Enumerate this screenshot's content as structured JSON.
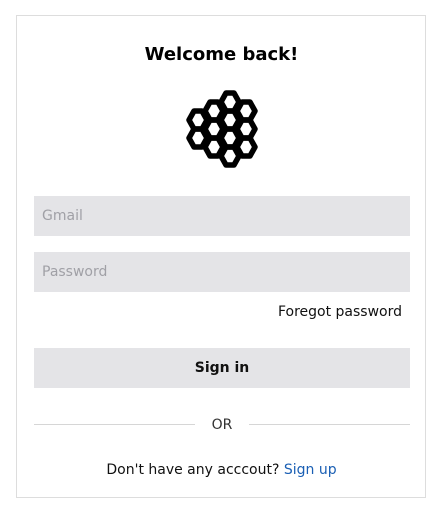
{
  "header": {
    "title": "Welcome back!"
  },
  "logo": {
    "icon": "honeycomb-icon",
    "color": "#000000"
  },
  "form": {
    "gmail": {
      "placeholder": "Gmail",
      "value": ""
    },
    "password": {
      "placeholder": "Password",
      "value": ""
    },
    "forgot_label": "Foregot password",
    "signin_label": "Sign in"
  },
  "divider": {
    "label": "OR"
  },
  "signup": {
    "prompt": "Don't have any acccout?",
    "link_label": "Sign up",
    "link_color": "#1a5fb4"
  },
  "colors": {
    "field_background": "#e4e4e7",
    "card_border": "#dddddd"
  }
}
